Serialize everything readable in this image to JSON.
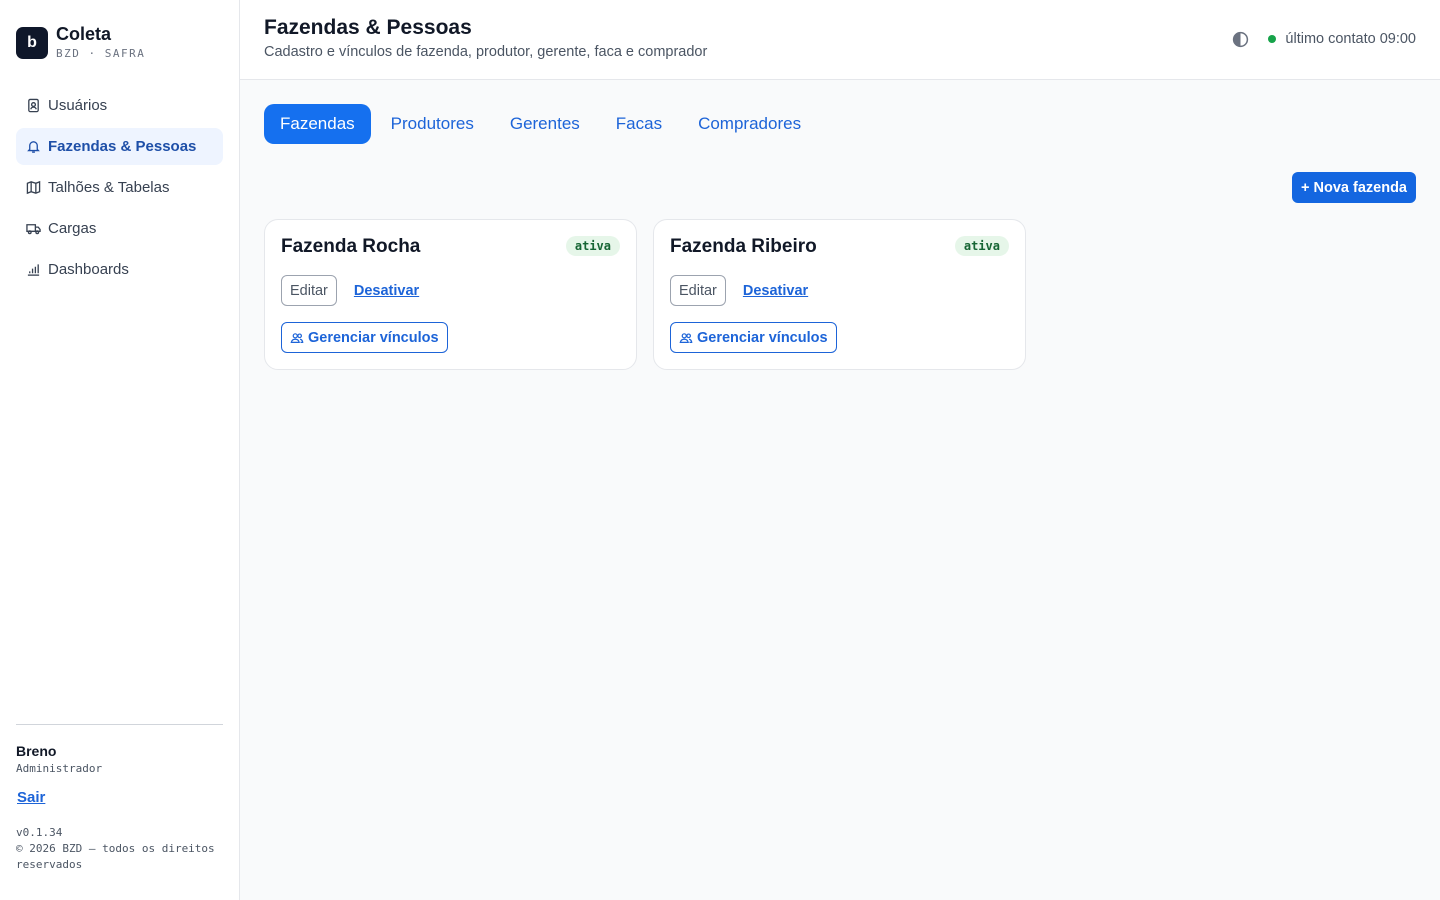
{
  "brand": {
    "logo_letter": "b",
    "name": "Coleta",
    "subtitle": "BZD · SAFRA"
  },
  "sidebar": {
    "items": [
      {
        "label": "Usuários",
        "icon": "user-card-icon",
        "active": false
      },
      {
        "label": "Fazendas & Pessoas",
        "icon": "bell-icon",
        "active": true
      },
      {
        "label": "Talhões & Tabelas",
        "icon": "map-icon",
        "active": false
      },
      {
        "label": "Cargas",
        "icon": "truck-icon",
        "active": false
      },
      {
        "label": "Dashboards",
        "icon": "bar-chart-icon",
        "active": false
      }
    ],
    "user": {
      "name": "Breno",
      "role": "Administrador"
    },
    "logout_label": "Sair",
    "version": "v0.1.34",
    "copyright": "© 2026 BZD — todos os direitos reservados"
  },
  "header": {
    "title": "Fazendas & Pessoas",
    "subtitle": "Cadastro e vínculos de fazenda, produtor, gerente, faca e comprador",
    "status_text": "último contato 09:00",
    "status_color": "#16a34a"
  },
  "tabs": [
    {
      "label": "Fazendas",
      "active": true
    },
    {
      "label": "Produtores",
      "active": false
    },
    {
      "label": "Gerentes",
      "active": false
    },
    {
      "label": "Facas",
      "active": false
    },
    {
      "label": "Compradores",
      "active": false
    }
  ],
  "new_button_label": "+ Nova fazenda",
  "farms": [
    {
      "name": "Fazenda Rocha",
      "status": "ativa",
      "edit_label": "Editar",
      "deactivate_label": "Desativar",
      "links_label": "Gerenciar vínculos"
    },
    {
      "name": "Fazenda Ribeiro",
      "status": "ativa",
      "edit_label": "Editar",
      "deactivate_label": "Desativar",
      "links_label": "Gerenciar vínculos"
    }
  ],
  "colors": {
    "accent": "#1570ef",
    "badge_bg": "#e6f6e9",
    "badge_text": "#166534"
  }
}
